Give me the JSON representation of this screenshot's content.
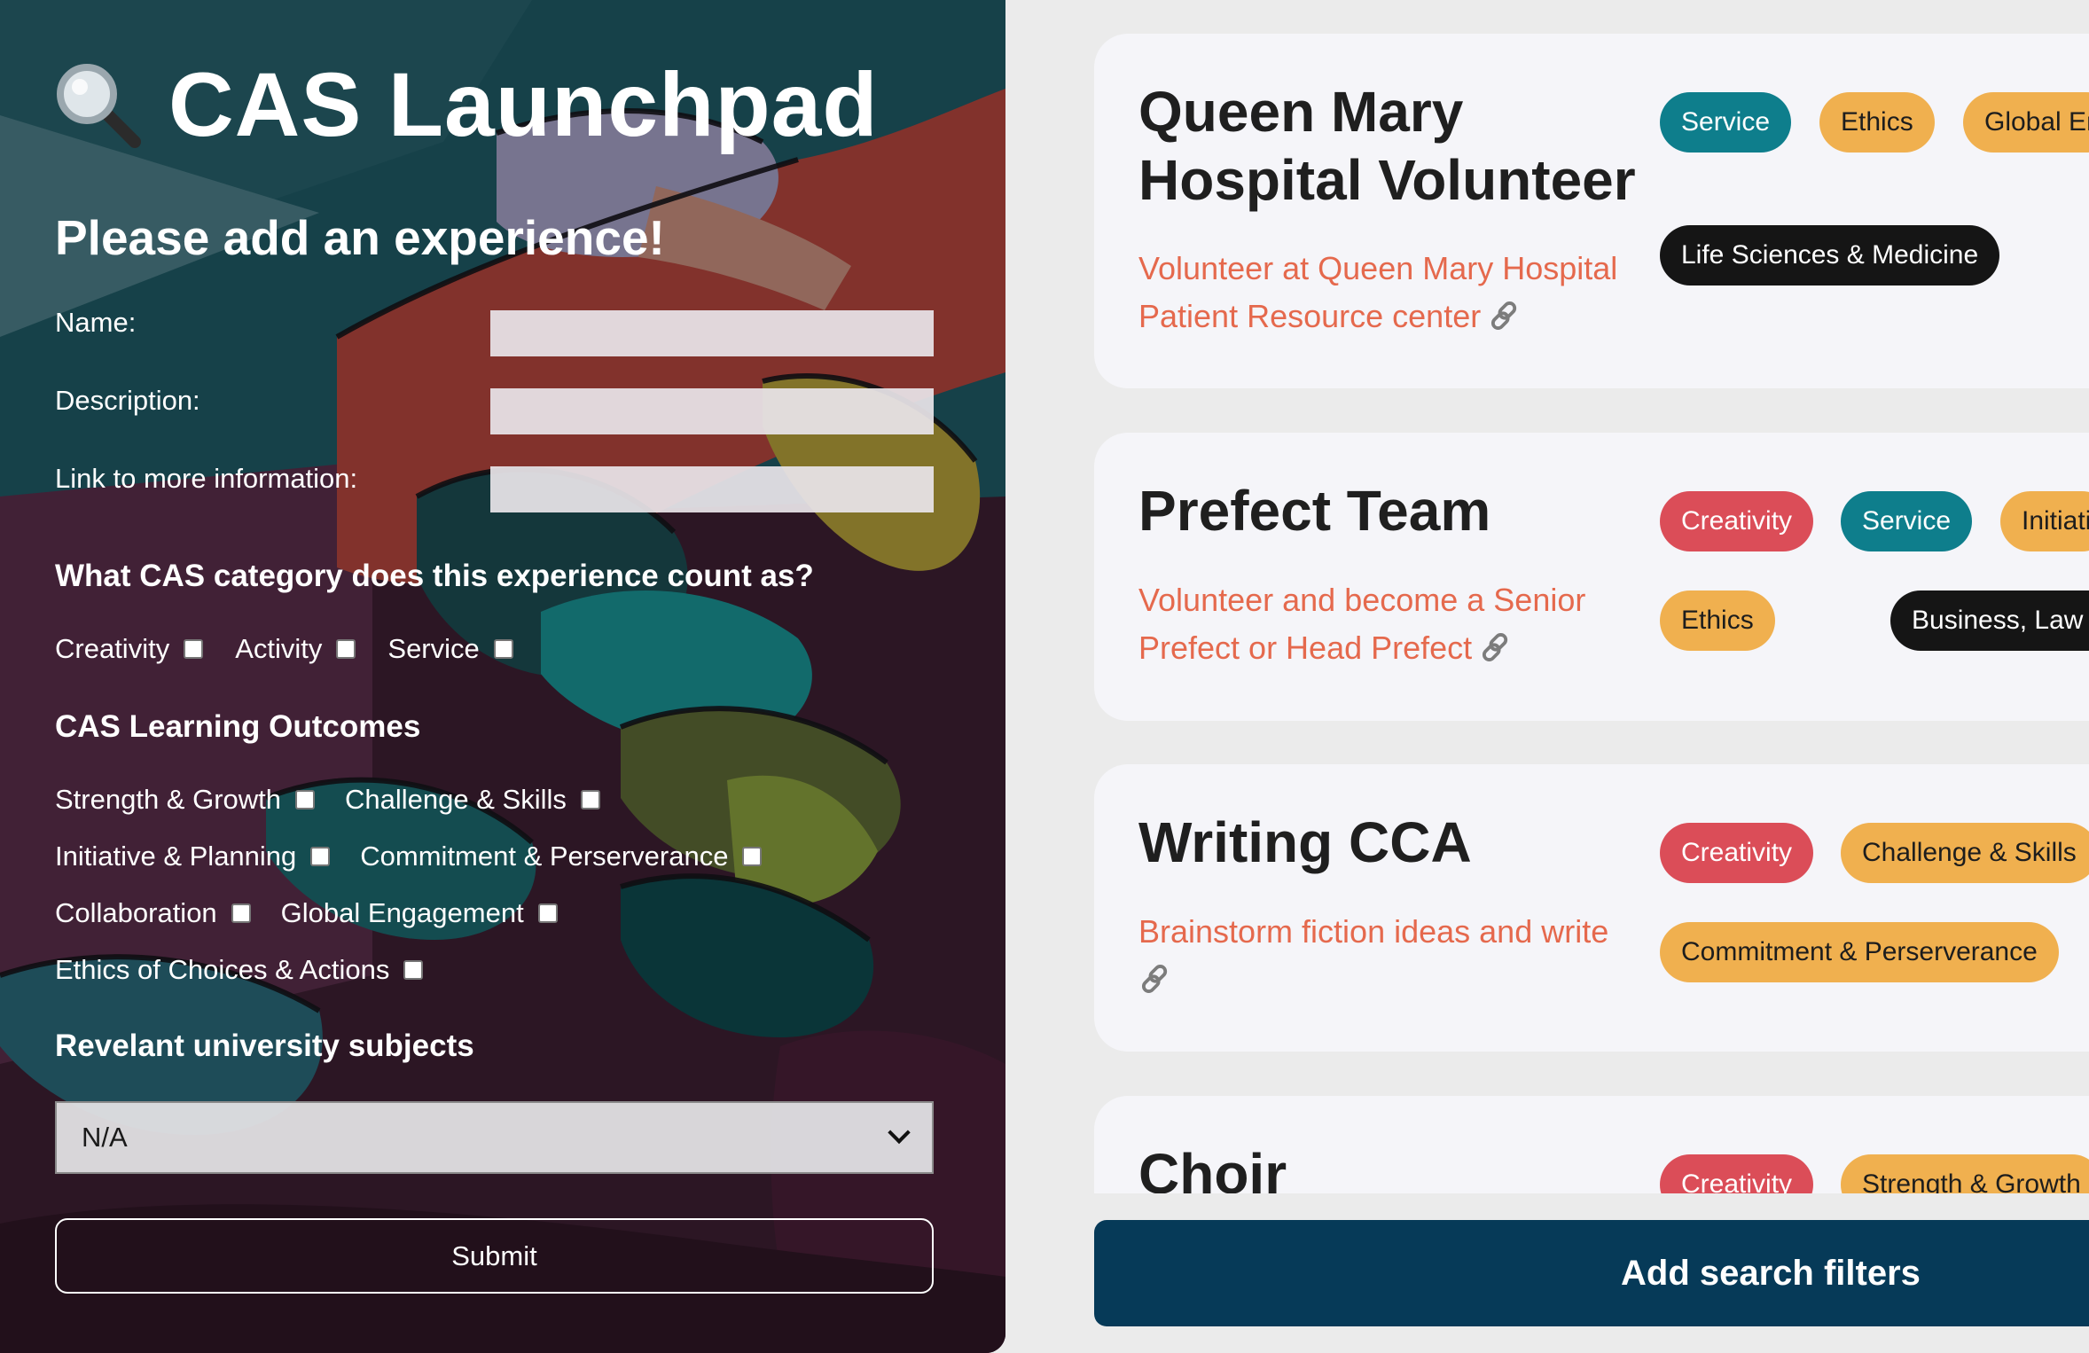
{
  "app": {
    "title": "CAS Launchpad"
  },
  "form": {
    "heading": "Please add an experience!",
    "name_label": "Name:",
    "description_label": "Description:",
    "link_label": "Link to more information:",
    "name_value": "",
    "description_value": "",
    "link_value": "",
    "category_heading": "What CAS category does this experience count as?",
    "categories": [
      "Creativity",
      "Activity",
      "Service"
    ],
    "outcomes_heading": "CAS Learning Outcomes",
    "outcomes": [
      "Strength & Growth",
      "Challenge & Skills",
      "Initiative & Planning",
      "Commitment & Perserverance",
      "Collaboration",
      "Global Engagement",
      "Ethics of Choices & Actions"
    ],
    "subjects_heading": "Revelant university subjects",
    "subject_selected": "N/A",
    "submit_label": "Submit"
  },
  "experiences": [
    {
      "title": "Queen Mary Hospital Volunteer",
      "description": "Volunteer at Queen Mary Hospital Patient Resource center",
      "tags": [
        "Service",
        "Ethics",
        "Global Er",
        "Life Sciences & Medicine"
      ]
    },
    {
      "title": "Prefect Team",
      "description": "Volunteer and become a Senior Prefect or Head Prefect",
      "tags": [
        "Creativity",
        "Service",
        "Initiati",
        "Ethics",
        "Business, Law and Ma"
      ]
    },
    {
      "title": "Writing CCA",
      "description": "Brainstorm fiction ideas and write",
      "tags": [
        "Creativity",
        "Challenge & Skills",
        "Commitment & Perserverance"
      ]
    },
    {
      "title": "Choir",
      "description": "",
      "tags": [
        "Creativity",
        "Strength & Growth"
      ]
    }
  ],
  "filters": {
    "button_label": "Add search filters"
  },
  "colors": {
    "tag_teal": "#0e7e8c",
    "tag_orange": "#f0b04f",
    "tag_red": "#db4d58",
    "tag_dark": "#151515",
    "description_text": "#e5694d",
    "filter_button": "#063a58"
  },
  "icons": {
    "title_icon": "magnifying-glass-icon",
    "link_icon": "link-icon",
    "select_arrow": "chevron-down-icon"
  }
}
